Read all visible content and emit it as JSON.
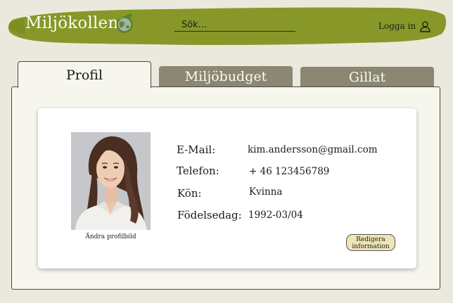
{
  "header": {
    "logo_text": "Miljökollen",
    "search_placeholder": "Sök...",
    "login_label": "Logga in",
    "brand_color": "#879828"
  },
  "tabs": [
    {
      "label": "Profil",
      "active": true
    },
    {
      "label": "Miljöbudget",
      "active": false
    },
    {
      "label": "Gillat",
      "active": false
    }
  ],
  "profile": {
    "change_photo_label": "Ändra profilbild",
    "fields": [
      {
        "label": "E-Mail:",
        "value": "kim.andersson@gmail.com"
      },
      {
        "label": "Telefon:",
        "value": "+ 46 123456789"
      },
      {
        "label": "Kön:",
        "value": "Kvinna"
      },
      {
        "label": "Födelsedag:",
        "value": "1992-03/04"
      }
    ],
    "edit_label_line1": "Redigera",
    "edit_label_line2": "information"
  }
}
